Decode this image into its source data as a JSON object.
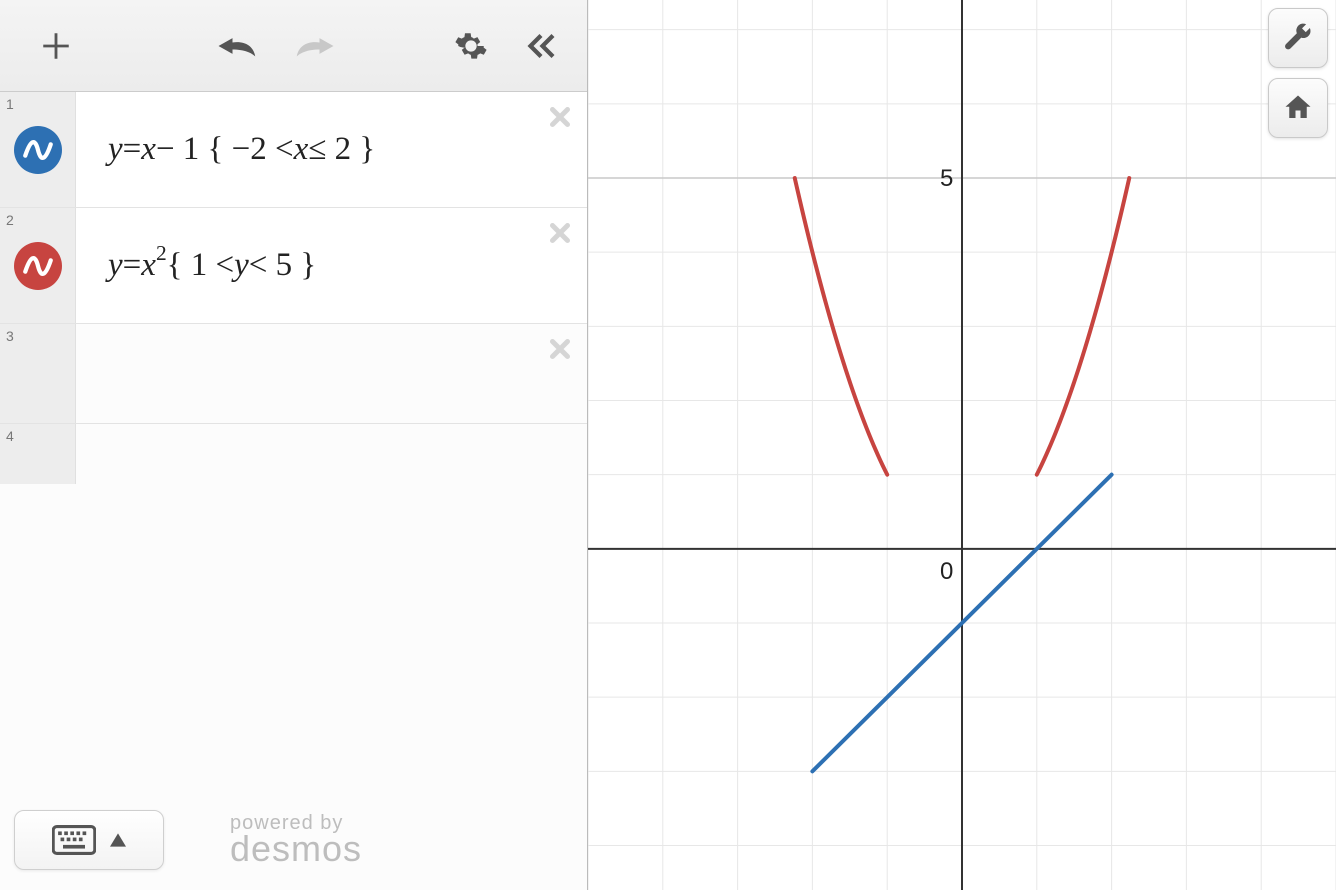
{
  "expressions": [
    {
      "index": "1",
      "color": "blue",
      "latex_html": "<span>y</span> <span class='upright'>=</span> <span>x</span> <span class='upright'>− 1 { −2 &lt;</span> <span>x</span> <span class='upright'>≤ 2 }</span>"
    },
    {
      "index": "2",
      "color": "red",
      "latex_html": "<span>y</span> <span class='upright'>=</span> <span>x</span><sup>2</sup> <span class='upright'>{ 1 &lt;</span> <span>y</span> <span class='upright'>&lt; 5 }</span>"
    },
    {
      "index": "3",
      "color": "",
      "latex_html": ""
    },
    {
      "index": "4",
      "color": "",
      "latex_html": ""
    }
  ],
  "branding": {
    "line1": "powered by",
    "line2": "desmos"
  },
  "graph": {
    "xmin": -5.0,
    "xmax": 5.0,
    "ymin": -4.6,
    "ymax": 7.4,
    "grid_step": 1,
    "tick_labels": [
      {
        "value": "5",
        "x": 0,
        "y": 5,
        "dx": -22,
        "dy": 8
      },
      {
        "value": "0",
        "x": 0,
        "y": 0,
        "dx": -22,
        "dy": 30
      }
    ]
  },
  "chart_data": [
    {
      "type": "line",
      "title": "",
      "xlabel": "",
      "ylabel": "",
      "xlim": [
        -5,
        5
      ],
      "ylim": [
        -4.6,
        7.4
      ],
      "series": [
        {
          "name": "y = x − 1  {−2 < x ≤ 2}",
          "color": "#2d70b3",
          "x": [
            -2,
            2
          ],
          "y": [
            -3,
            1
          ]
        },
        {
          "name": "y = x²  {1 < y < 5} (left branch)",
          "color": "#c74440",
          "x": [
            -2.236,
            -1.9,
            -1.6,
            -1.3,
            -1.0
          ],
          "y": [
            5.0,
            3.61,
            2.56,
            1.69,
            1.0
          ]
        },
        {
          "name": "y = x²  {1 < y < 5} (right branch)",
          "color": "#c74440",
          "x": [
            1.0,
            1.3,
            1.6,
            1.9,
            2.236
          ],
          "y": [
            1.0,
            1.69,
            2.56,
            3.61,
            5.0
          ]
        }
      ]
    }
  ]
}
